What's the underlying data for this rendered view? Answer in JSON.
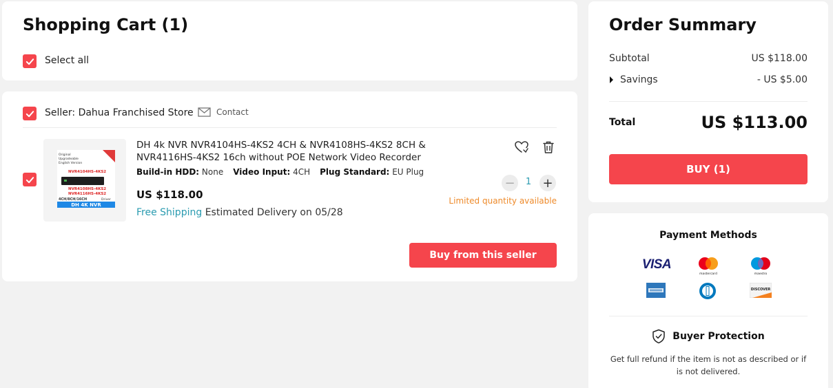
{
  "cart": {
    "title": "Shopping Cart (1)",
    "select_all_label": "Select all"
  },
  "seller": {
    "name": "Seller: Dahua Franchised Store",
    "contact_label": "Contact",
    "buy_from_seller_label": "Buy from this seller"
  },
  "item": {
    "title": "DH 4k NVR NVR4104HS-4KS2 4CH & NVR4108HS-4KS2 8CH & NVR4116HS-4KS2 16ch without POE Network Video Recorder",
    "specs": [
      {
        "label": "Build-in HDD:",
        "value": "None"
      },
      {
        "label": "Video Input:",
        "value": "4CH"
      },
      {
        "label": "Plug Standard:",
        "value": "EU Plug"
      }
    ],
    "price": "US $118.00",
    "free_shipping": "Free Shipping",
    "delivery": "Estimated Delivery on 05/28",
    "quantity": "1",
    "limited_note": "Limited quantity available",
    "thumb": {
      "tag1": "Original",
      "tag2": "Upgradeable",
      "tag3": "English Version",
      "model1": "NVR4104HS-4KS2",
      "model2": "NVR4108HS-4KS2",
      "model3": "NVR4116HS-4KS2",
      "channels": "4CH/8CH/16CH",
      "brand": "Driver",
      "banner": "DH 4K NVR"
    }
  },
  "summary": {
    "title": "Order Summary",
    "subtotal_label": "Subtotal",
    "subtotal_value": "US $118.00",
    "savings_label": "Savings",
    "savings_value": "- US $5.00",
    "total_label": "Total",
    "total_value": "US $113.00",
    "buy_label": "BUY (1)"
  },
  "payment": {
    "title": "Payment Methods",
    "methods": [
      "visa",
      "mastercard",
      "maestro",
      "american-express",
      "diners-club",
      "discover"
    ],
    "logo_text": {
      "visa": "VISA",
      "mastercard": "mastercard",
      "maestro": "maestro",
      "discover": "DISCOVER"
    },
    "protection_title": "Buyer Protection",
    "protection_text": "Get full refund if the item is not as described or if is not delivered."
  },
  "colors": {
    "accent": "#f5454c",
    "link": "#2a9bb0",
    "warning": "#ee8a2a"
  }
}
